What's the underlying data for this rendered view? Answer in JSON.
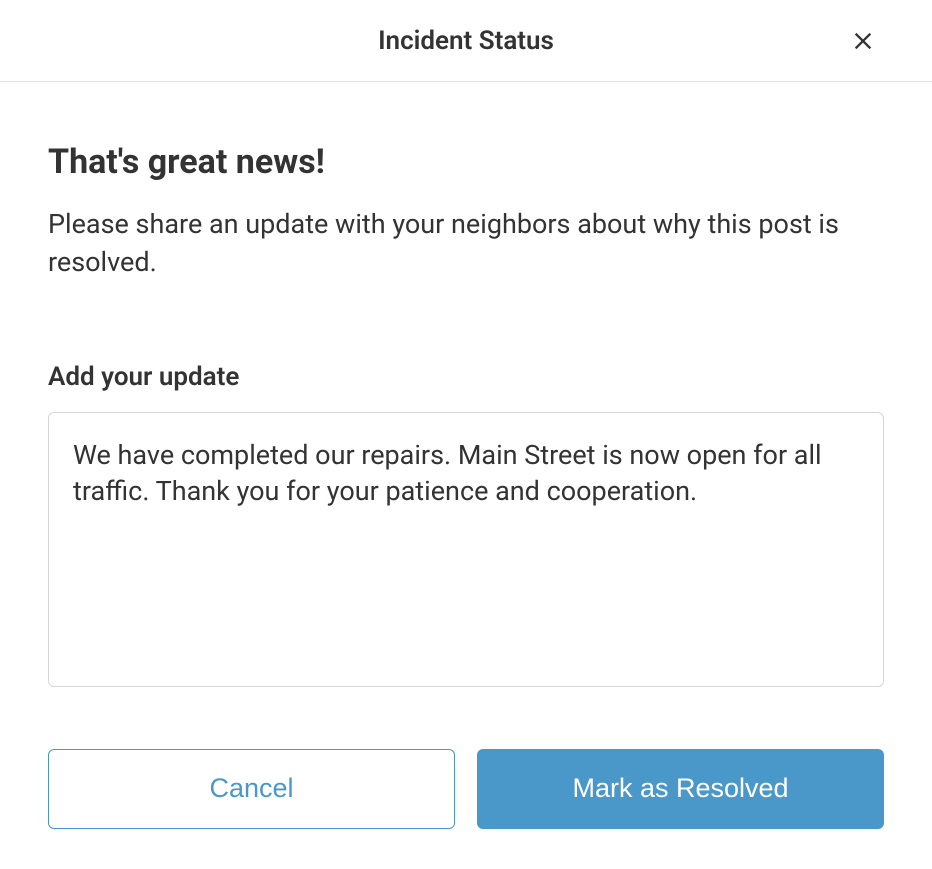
{
  "header": {
    "title": "Incident Status"
  },
  "body": {
    "heading": "That's great news!",
    "description": "Please share an update with your neighbors about why this post is resolved.",
    "field_label": "Add your update",
    "textarea_value": "We have completed our repairs. Main Street is now open for all traffic. Thank you for your patience and cooperation."
  },
  "buttons": {
    "cancel": "Cancel",
    "resolve": "Mark as Resolved"
  }
}
